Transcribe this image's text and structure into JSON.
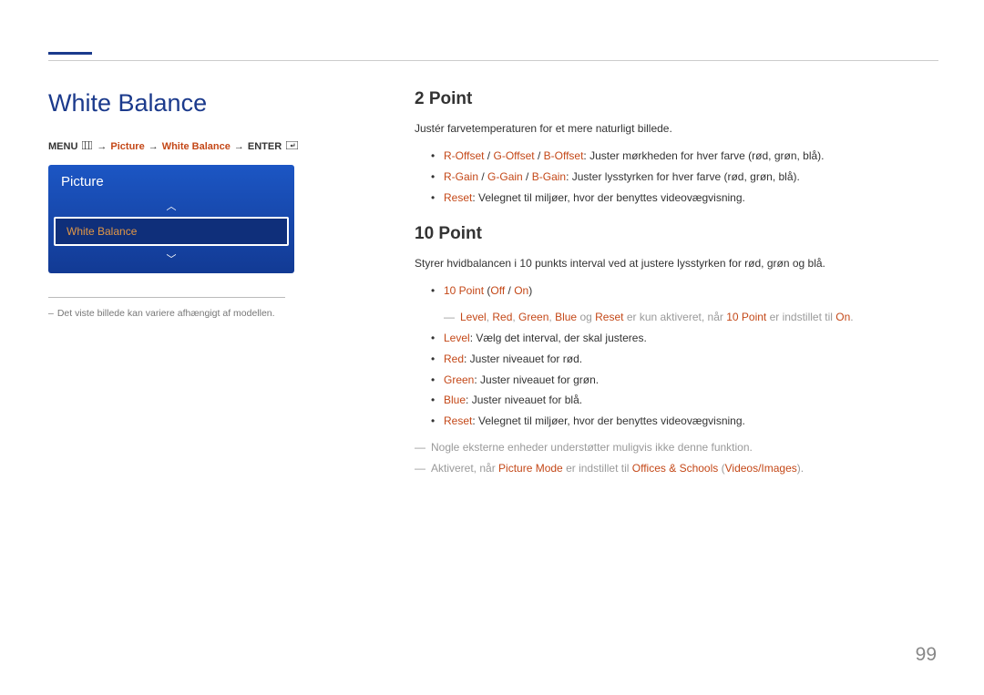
{
  "page_number": "99",
  "left": {
    "title": "White Balance",
    "breadcrumb": {
      "menu_label": "MENU",
      "arrow": "→",
      "part1": "Picture",
      "part2": "White Balance",
      "enter_label": "ENTER"
    },
    "menu": {
      "header": "Picture",
      "up": "︿",
      "item": "White Balance",
      "down": "﹀"
    },
    "note": "Det viste billede kan variere afhængigt af modellen."
  },
  "right": {
    "s2": {
      "heading": "2 Point",
      "intro": "Justér farvetemperaturen for et mere naturligt billede.",
      "b1_hl1": "R-Offset",
      "b1_sep": " / ",
      "b1_hl2": "G-Offset",
      "b1_hl3": "B-Offset",
      "b1_rest": ": Juster mørkheden for hver farve (rød, grøn, blå).",
      "b2_hl1": "R-Gain",
      "b2_hl2": "G-Gain",
      "b2_hl3": "B-Gain",
      "b2_rest": ": Juster lysstyrken for hver farve (rød, grøn, blå).",
      "b3_hl": "Reset",
      "b3_rest": ": Velegnet til miljøer, hvor der benyttes videovægvisning."
    },
    "s10": {
      "heading": "10 Point",
      "intro": "Styrer hvidbalancen i 10 punkts interval ved at justere lysstyrken for rød, grøn og blå.",
      "b1_hl": "10 Point",
      "b1_paren_open": " (",
      "b1_off": "Off",
      "b1_slash": " / ",
      "b1_on": "On",
      "b1_paren_close": ")",
      "sub1_pre": "―  ",
      "sub1_level": "Level",
      "sub1_c1": ", ",
      "sub1_red": "Red",
      "sub1_green": "Green",
      "sub1_blue": "Blue",
      "sub1_og": " og ",
      "sub1_reset": "Reset",
      "sub1_mid": " er kun aktiveret, når ",
      "sub1_10p": "10 Point",
      "sub1_mid2": " er indstillet til ",
      "sub1_onv": "On",
      "sub1_end": ".",
      "b2_hl": "Level",
      "b2_rest": ": Vælg det interval, der skal justeres.",
      "b3_hl": "Red",
      "b3_rest": ": Juster niveauet for rød.",
      "b4_hl": "Green",
      "b4_rest": ": Juster niveauet for grøn.",
      "b5_hl": "Blue",
      "b5_rest": ": Juster niveauet for blå.",
      "b6_hl": "Reset",
      "b6_rest": ": Velegnet til miljøer, hvor der benyttes videovægvisning.",
      "foot1_pre": "―  ",
      "foot1": "Nogle eksterne enheder understøtter muligvis ikke denne funktion.",
      "foot2_pre": "―  ",
      "foot2_a": "Aktiveret, når ",
      "foot2_pm": "Picture Mode",
      "foot2_b": " er indstillet til ",
      "foot2_os": "Offices & Schools",
      "foot2_p1": " (",
      "foot2_vi": "Videos/Images",
      "foot2_p2": ")."
    }
  }
}
